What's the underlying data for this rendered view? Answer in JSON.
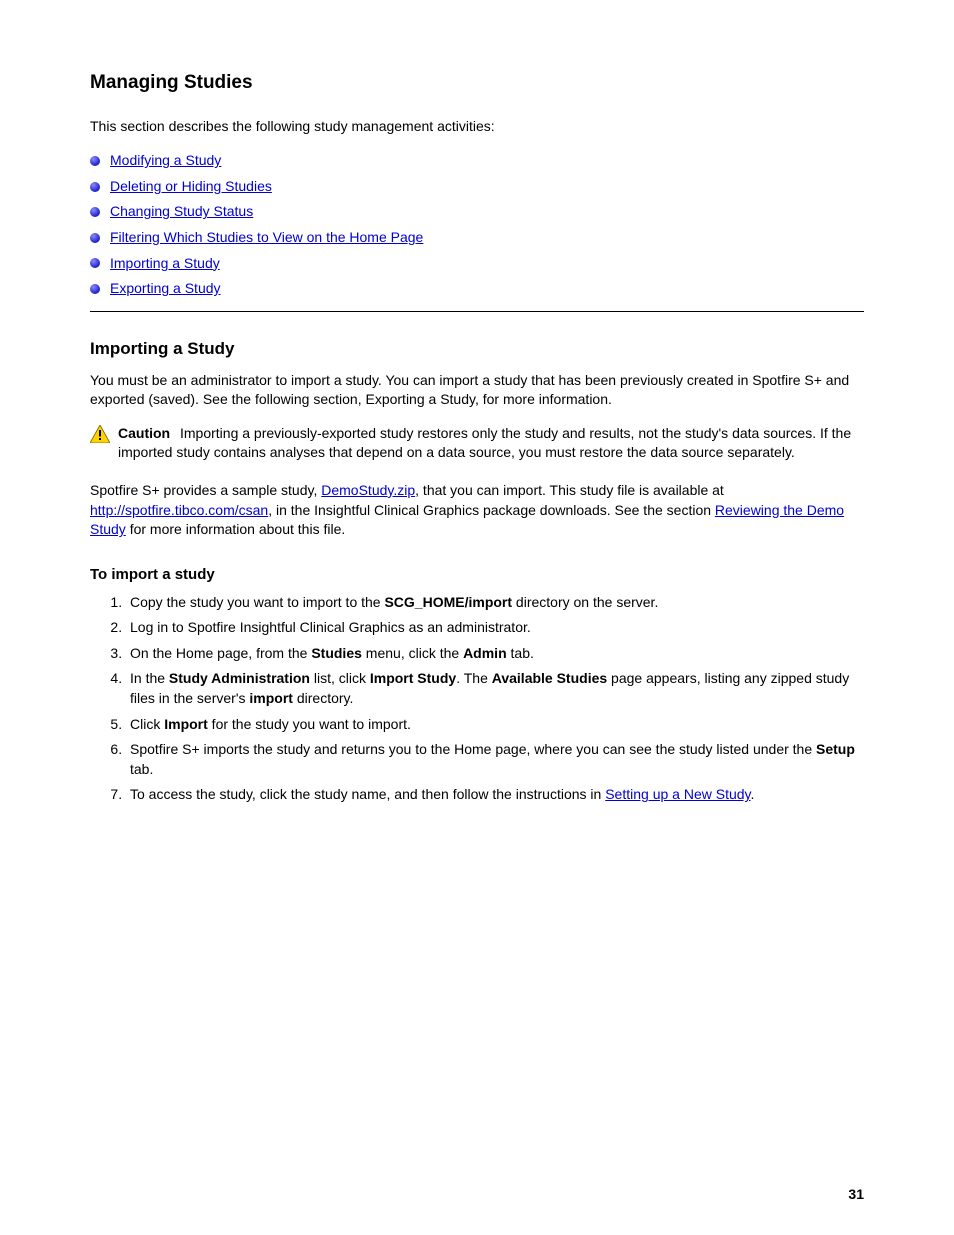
{
  "section_title": "Managing Studies",
  "intro": "This section describes the following study management activities:",
  "links": [
    "Modifying a Study",
    "Deleting or Hiding Studies",
    "Changing Study Status",
    "Filtering Which Studies to View on the Home Page",
    "Importing a Study",
    "Exporting a Study"
  ],
  "subhead": "Importing a Study",
  "p1": "You must be an administrator to import a study. You can import a study that has been previously created in Spotfire S+ and exported (saved). See the following section, Exporting a Study, for more information.",
  "caution_label": "Caution",
  "caution_text": "Importing a previously-exported study restores only the study and results, not the study's data sources. If the imported study contains analyses that depend on a data source, you must restore the data source separately.",
  "p2_pre": "Spotfire S+ provides a sample study, ",
  "p2_link1": "DemoStudy.zip",
  "p2_mid1": ", that you can import. This study file is available at ",
  "p2_link2": "http://spotfire.tibco.com/csan",
  "p2_mid2": ", in the Insightful Clinical Graphics package downloads. See the section ",
  "p2_link3": "Reviewing the Demo Study",
  "p2_after": " for more information about this file.",
  "subsub": "To import a study",
  "step1_pre": "Copy the study you want to import to the ",
  "step1_bold": "SCG_HOME/import",
  "step1_after": " directory on the server.",
  "step2": "Log in to Spotfire Insightful Clinical Graphics as an administrator.",
  "step3_pre": "On the Home page, from the ",
  "step3_bold": "Studies",
  "step3_mid": " menu, click the ",
  "step3_bold2": "Admin",
  "step3_after": " tab.",
  "step4_pre": "In the ",
  "step4_bold": "Study Administration",
  "step4_mid1": " list, click ",
  "step4_bold2": "Import Study",
  "step4_mid2": ". The ",
  "step4_bold3": "Available Studies",
  "step4_mid3": " page appears, listing any zipped study files in the server's ",
  "step4_bold4": "import",
  "step4_after": " directory.",
  "step5_pre": "Click ",
  "step5_bold": "Import",
  "step5_after": " for the study you want to import.",
  "step6_pre": "Spotfire S+ imports the study and returns you to the Home page, where you can see the study listed under the ",
  "step6_bold": "Setup",
  "step6_after": " tab.",
  "step7_pre": "To access the study, click the study name, and then follow the instructions in ",
  "step7_link": "Setting up a New Study",
  "step7_after": ".",
  "page_number": "31"
}
